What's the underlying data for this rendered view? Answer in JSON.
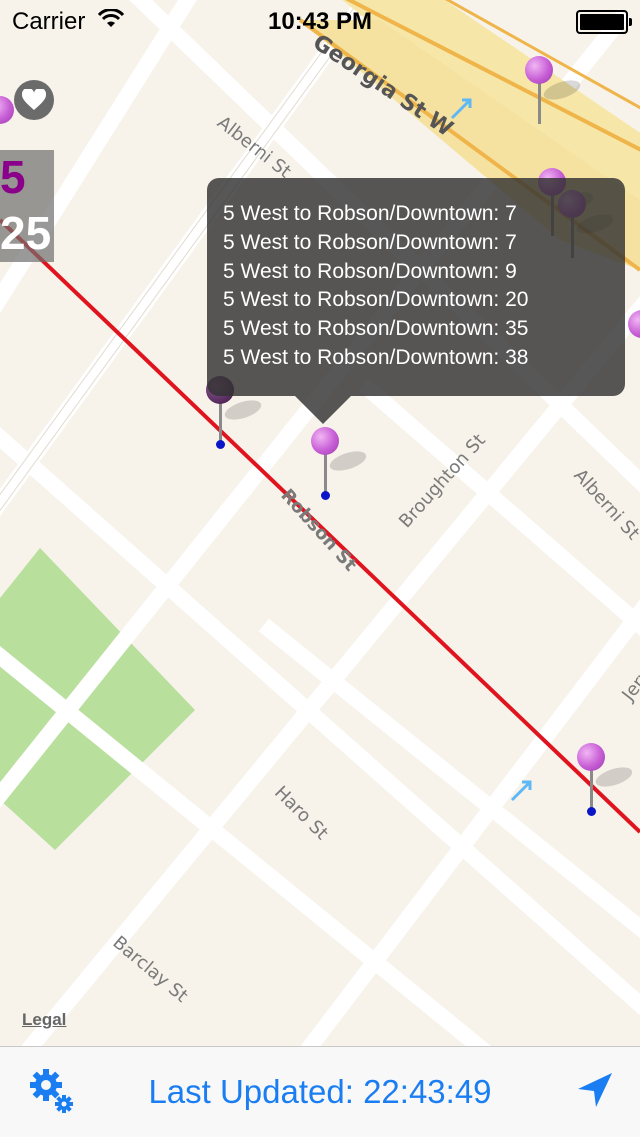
{
  "status_bar": {
    "carrier": "Carrier",
    "time": "10:43 PM"
  },
  "map": {
    "streets": {
      "georgia": "Georgia St W",
      "alberni_top": "Alberni St",
      "alberni_right": "Alberni St",
      "robson": "Robson St",
      "broughton": "Broughton St",
      "haro": "Haro St",
      "barclay": "Barclay St",
      "jervis": "Jervi"
    },
    "route_indicator": {
      "route": "5",
      "minutes": "25"
    },
    "callout": {
      "lines": [
        "5 West to Robson/Downtown: 7",
        "5 West to Robson/Downtown: 7",
        "5 West to Robson/Downtown: 9",
        "5 West to Robson/Downtown: 20",
        "5 West to Robson/Downtown: 35",
        "5 West to Robson/Downtown: 38"
      ]
    },
    "legal": "Legal"
  },
  "toolbar": {
    "last_updated": "Last Updated: 22:43:49"
  },
  "colors": {
    "accent": "#1a7ef2",
    "route_line": "#e0141e",
    "route_number": "#8b008b",
    "pin": "#c75dd5"
  },
  "icons": [
    "wifi-icon",
    "battery-icon",
    "heart-icon",
    "settings-gear-icon",
    "location-arrow-icon"
  ]
}
